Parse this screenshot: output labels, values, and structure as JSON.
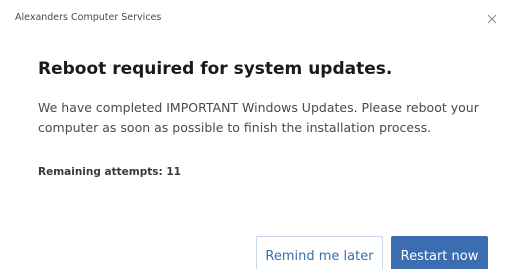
{
  "window": {
    "title": "Alexanders Computer Services",
    "close_icon": "close-icon"
  },
  "dialog": {
    "heading": "Reboot required for system updates.",
    "message": "We have completed IMPORTANT Windows Updates. Please reboot your computer as soon as possible to finish the installation process.",
    "attempts_label": "Remaining attempts: 11"
  },
  "buttons": {
    "remind_label": "Remind me later",
    "restart_label": "Restart now"
  },
  "colors": {
    "accent": "#3b6db0",
    "secondary_text": "#3a6fae",
    "background": "#ffffff"
  }
}
